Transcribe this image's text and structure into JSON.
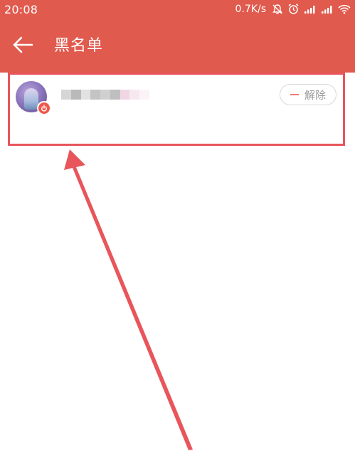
{
  "status_bar": {
    "time": "20:08",
    "network_speed": "0.7K/s",
    "icons": [
      "mute-bell-icon",
      "alarm-icon",
      "signal-icon",
      "signal-icon",
      "wifi-icon"
    ]
  },
  "app_bar": {
    "back_icon": "back-arrow-icon",
    "title": "黑名单"
  },
  "blacklist": {
    "items": [
      {
        "avatar_icon": "avatar",
        "badge_icon": "power-badge-icon",
        "name_obscured": true,
        "unblock_label": "解除"
      }
    ]
  },
  "annotation": {
    "color": "#e8555a"
  },
  "colors": {
    "accent": "#e05b4e",
    "button_border": "#d8d8d8",
    "button_text": "#9a9a9a",
    "minus": "#f07a6d"
  }
}
